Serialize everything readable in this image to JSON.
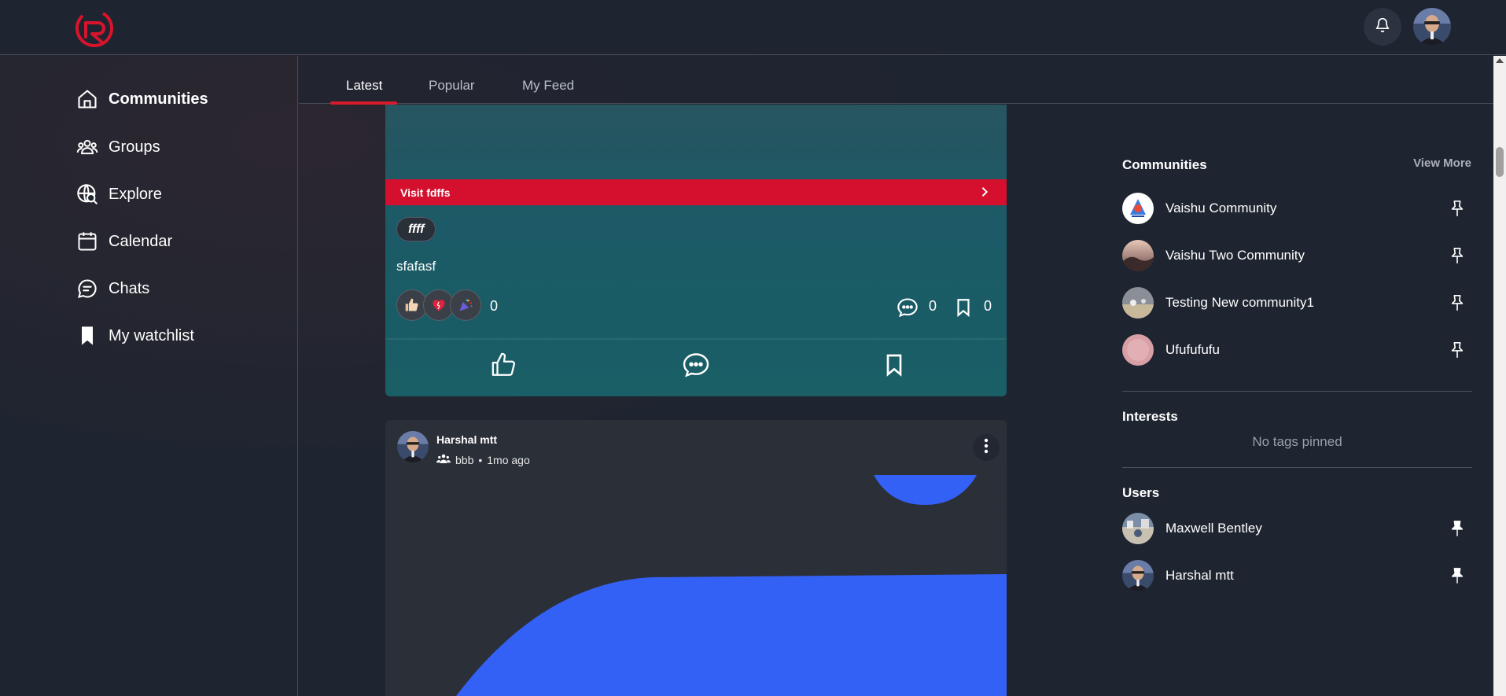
{
  "header": {
    "logo": "rg-logo",
    "notification_icon": "bell-icon"
  },
  "sidebar": {
    "items": [
      {
        "label": "Communities",
        "icon": "home-icon",
        "active": true
      },
      {
        "label": "Groups",
        "icon": "people-icon"
      },
      {
        "label": "Explore",
        "icon": "globe-search-icon"
      },
      {
        "label": "Calendar",
        "icon": "calendar-icon"
      },
      {
        "label": "Chats",
        "icon": "chat-icon"
      },
      {
        "label": "My watchlist",
        "icon": "bookmark-icon"
      }
    ]
  },
  "tabs": [
    {
      "label": "Latest",
      "active": true
    },
    {
      "label": "Popular"
    },
    {
      "label": "My Feed"
    }
  ],
  "feed": {
    "post1": {
      "visit_label": "Visit fdffs",
      "tag": "ffff",
      "text": "sfafasf",
      "reactions": [
        "thumbs-up",
        "heart",
        "party"
      ],
      "reaction_count": "0",
      "comment_count": "0",
      "bookmark_count": "0"
    },
    "post2": {
      "author": "Harshal mtt",
      "group": "bbb",
      "separator": "•",
      "time": "1mo ago"
    }
  },
  "right_panel": {
    "communities": {
      "title": "Communities",
      "view_more": "View More",
      "items": [
        {
          "name": "Vaishu Community"
        },
        {
          "name": "Vaishu Two Community"
        },
        {
          "name": "Testing New community1"
        },
        {
          "name": "Ufufufufu"
        }
      ]
    },
    "interests": {
      "title": "Interests",
      "empty": "No tags pinned"
    },
    "users": {
      "title": "Users",
      "items": [
        {
          "name": "Maxwell Bentley"
        },
        {
          "name": "Harshal mtt"
        }
      ]
    }
  },
  "colors": {
    "accent": "#d50f2e",
    "background": "#1e2530",
    "card_teal": "#1a5e66",
    "shape_blue": "#3461f5"
  }
}
